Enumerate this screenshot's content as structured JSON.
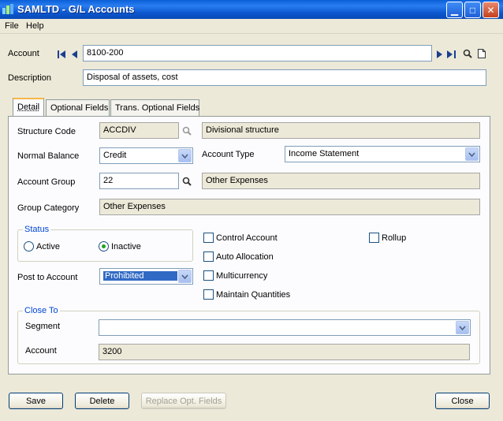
{
  "window": {
    "title": "SAMLTD - G/L Accounts"
  },
  "menu": {
    "items": [
      "File",
      "Help"
    ]
  },
  "header": {
    "account_label": "Account",
    "account_value": "8100-200",
    "description_label": "Description",
    "description_value": "Disposal of assets, cost"
  },
  "tabs": [
    "Detail",
    "Optional Fields",
    "Trans. Optional Fields"
  ],
  "detail": {
    "structure_code_label": "Structure Code",
    "structure_code_value": "ACCDIV",
    "structure_code_desc": "Divisional structure",
    "normal_balance_label": "Normal Balance",
    "normal_balance_value": "Credit",
    "account_type_label": "Account Type",
    "account_type_value": "Income Statement",
    "account_group_label": "Account Group",
    "account_group_value": "22",
    "account_group_desc": "Other Expenses",
    "group_category_label": "Group Category",
    "group_category_value": "Other Expenses",
    "status_title": "Status",
    "status_active": "Active",
    "status_inactive": "Inactive",
    "post_to_label": "Post to Account",
    "post_to_value": "Prohibited",
    "checkboxes": {
      "control_account": "Control Account",
      "auto_allocation": "Auto Allocation",
      "multicurrency": "Multicurrency",
      "maintain_quantities": "Maintain Quantities",
      "rollup": "Rollup"
    },
    "close_to_title": "Close To",
    "segment_label": "Segment",
    "segment_value": "",
    "close_account_label": "Account",
    "close_account_value": "3200"
  },
  "buttons": {
    "save": "Save",
    "delete": "Delete",
    "replace": "Replace Opt. Fields",
    "close": "Close"
  }
}
